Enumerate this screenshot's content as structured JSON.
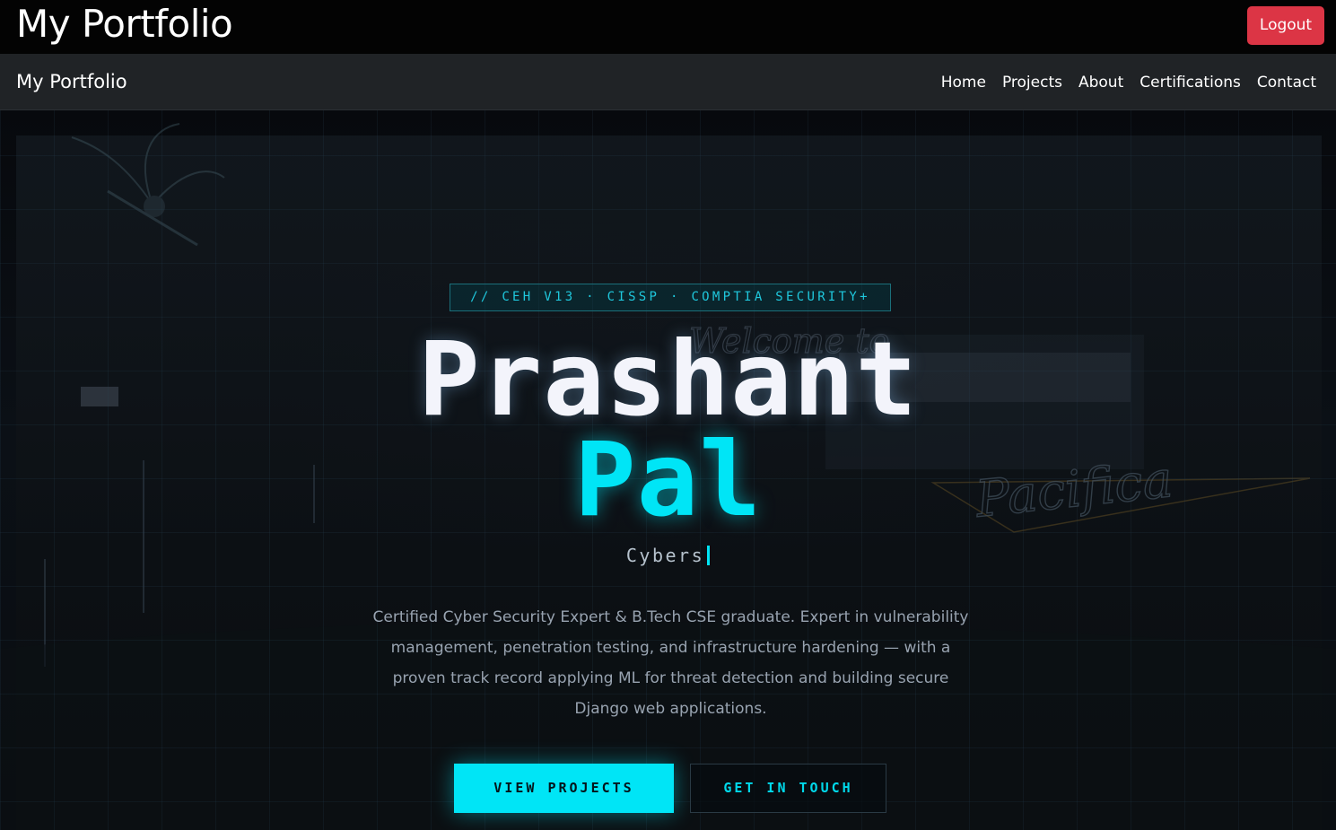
{
  "header": {
    "site_title": "My Portfolio",
    "logout_label": "Logout"
  },
  "navbar": {
    "brand": "My Portfolio",
    "links": [
      "Home",
      "Projects",
      "About",
      "Certifications",
      "Contact"
    ]
  },
  "hero": {
    "badge": "// CEH V13 · CISSP · COMPTIA SECURITY+",
    "first_name": "Prashant",
    "last_name": "Pal",
    "typed_text": "Cybers",
    "bio": "Certified Cyber Security Expert & B.Tech CSE graduate. Expert in vulnerability management, penetration testing, and infrastructure hardening — with a proven track record applying ML for threat detection and building secure Django web applications.",
    "primary_button": "VIEW PROJECTS",
    "secondary_button": "GET IN TOUCH",
    "background_sign_1": "Welcome to",
    "background_sign_2": "Pacifica"
  },
  "colors": {
    "accent": "#00e5f6",
    "logout": "#dc3545",
    "navbar": "#202326",
    "topbar": "#030303"
  }
}
